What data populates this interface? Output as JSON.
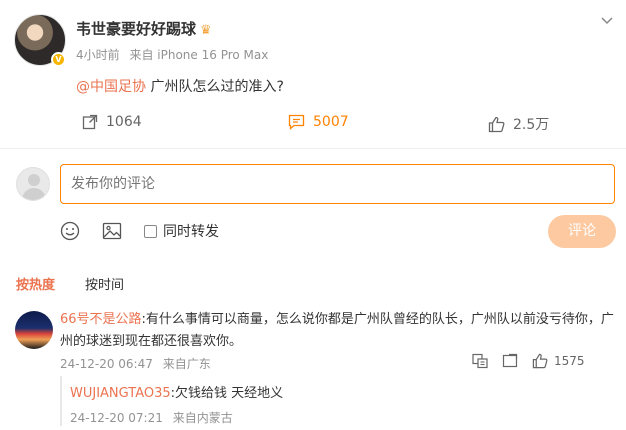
{
  "post": {
    "username": "韦世豪要好好踢球",
    "time": "4小时前",
    "source": "来自 iPhone 16 Pro Max",
    "mention": "@中国足协",
    "text": "广州队怎么过的准入?",
    "reposts": "1064",
    "comments": "5007",
    "likes": "2.5万",
    "crown_icon": "crown-icon",
    "verified_badge": "V"
  },
  "composer": {
    "placeholder": "发布你的评论",
    "repost_label": "同时转发",
    "submit_label": "评论"
  },
  "sort": {
    "hot_label": "按热度",
    "time_label": "按时间"
  },
  "comment": {
    "user": "66号不是公路",
    "text": ":有什么事情可以商量，怎么说你都是广州队曾经的队长，广州队以前没亏待你，广州的球迷到现在都还很喜欢你。",
    "time": "24-12-20 06:47",
    "location": "来自广东",
    "likes": "1575"
  },
  "reply": {
    "user": "WUJIANGTAO35",
    "text": ":欠钱给钱 天经地义",
    "time": "24-12-20 07:21",
    "location": "来自内蒙古"
  },
  "colors": {
    "accent": "#ff8200",
    "link": "#eb7350",
    "muted": "#939393",
    "submit_disabled": "#fdc9a0"
  }
}
